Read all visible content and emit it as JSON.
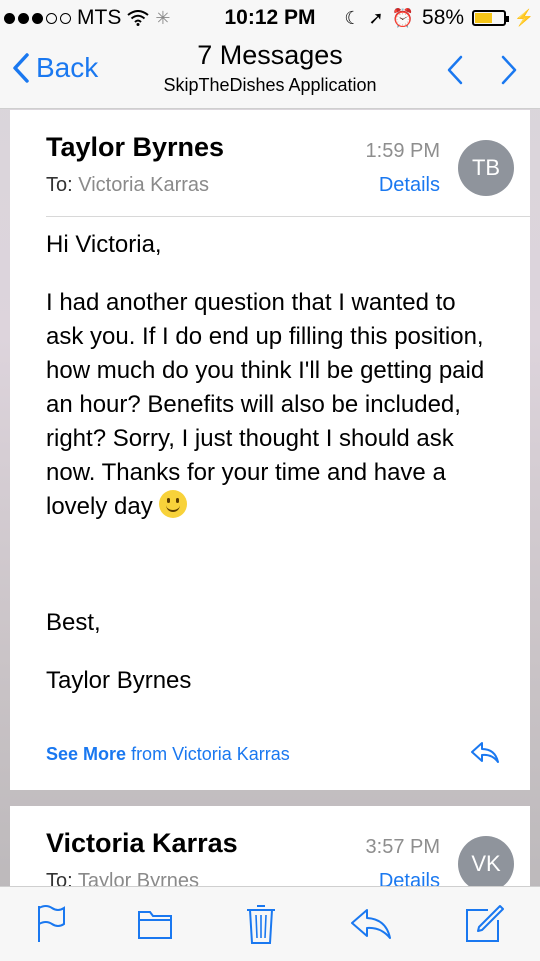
{
  "status_bar": {
    "carrier": "MTS",
    "time": "10:12 PM",
    "battery": "58%"
  },
  "nav": {
    "back_label": "Back",
    "title": "7 Messages",
    "subtitle": "SkipTheDishes Application"
  },
  "message1": {
    "sender": "Taylor Byrnes",
    "time": "1:59 PM",
    "to_label": "To:",
    "recipient": "Victoria Karras",
    "details_label": "Details",
    "avatar_initials": "TB",
    "greeting": "Hi Victoria,",
    "paragraph": "I had another question that I wanted to ask you. If I do end up filling this position, how much do you think I'll be getting paid an hour? Benefits will also be included, right? Sorry, I just thought I should ask now. Thanks for your time and have a lovely day",
    "signoff": "Best,",
    "signature": "Taylor Byrnes",
    "see_more_label": "See More",
    "see_more_from": "from Victoria Karras"
  },
  "message2": {
    "sender": "Victoria Karras",
    "time": "3:57 PM",
    "to_label": "To:",
    "recipient": "Taylor Byrnes",
    "details_label": "Details",
    "avatar_initials": "VK"
  },
  "colors": {
    "accent": "#1a78f0",
    "avatar": "#8f949c",
    "battery": "#f5c518"
  },
  "icons": [
    "back-chevron-icon",
    "up-arrow-icon",
    "down-arrow-icon",
    "flag-icon",
    "folder-icon",
    "trash-icon",
    "reply-icon",
    "compose-icon",
    "smiley-icon"
  ]
}
